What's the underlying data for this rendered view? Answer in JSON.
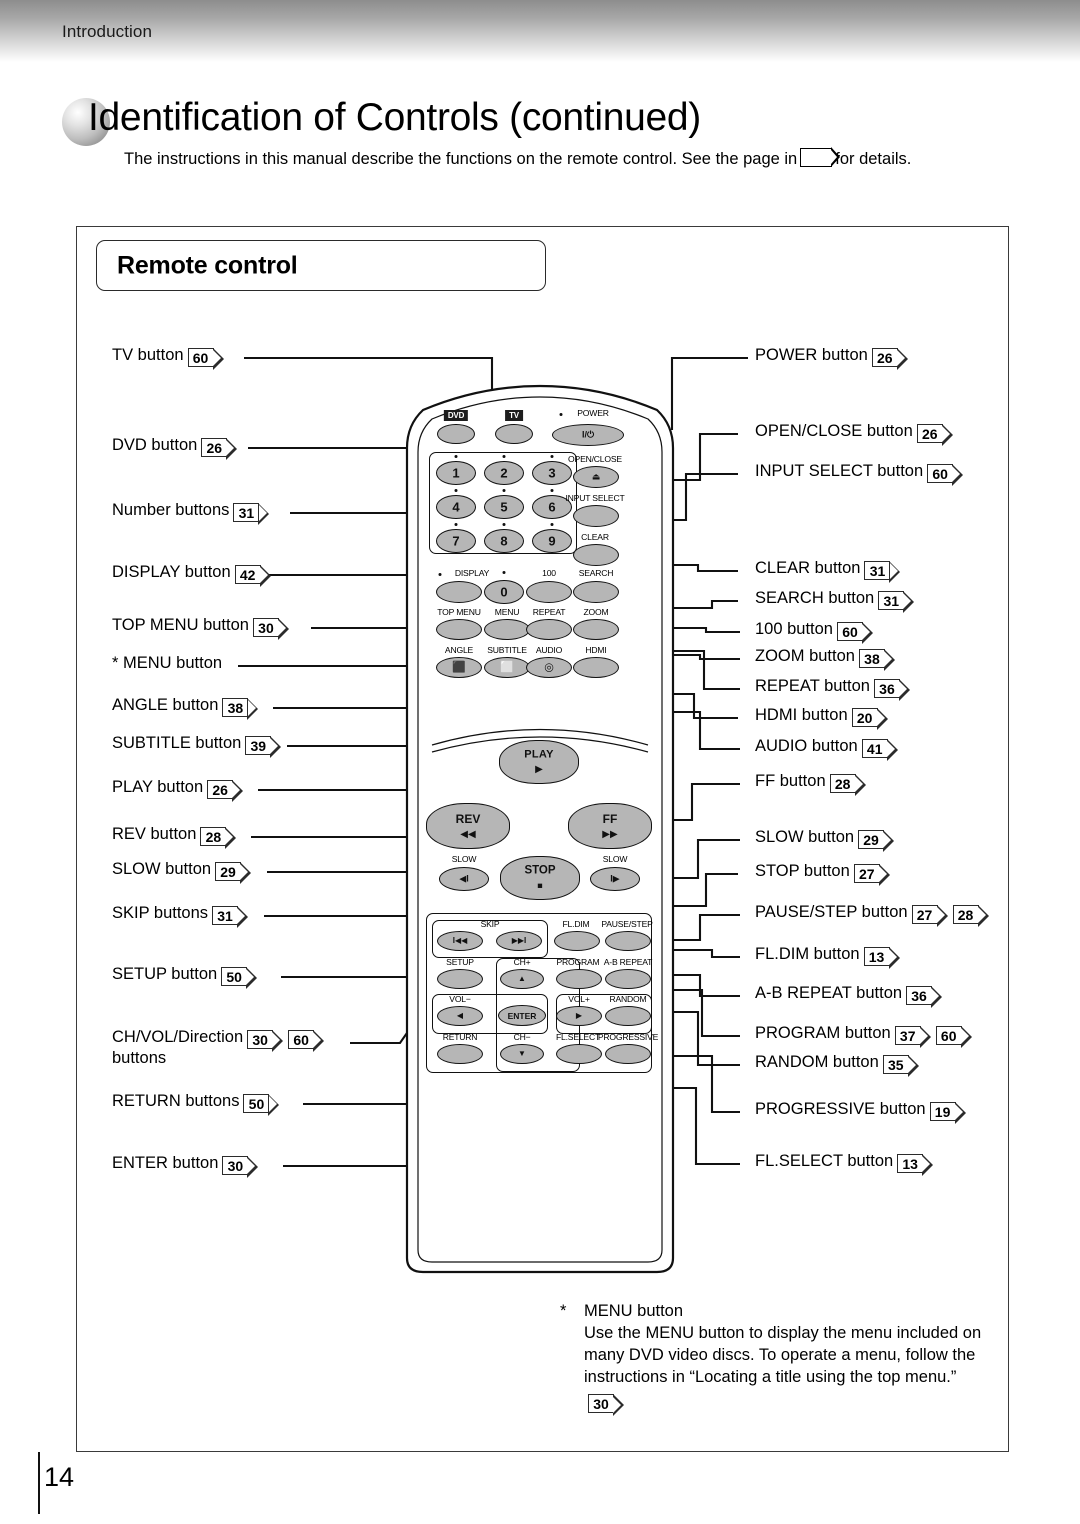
{
  "header": {
    "breadcrumb": "Introduction",
    "title": "Identification of Controls (continued)",
    "subtitle_before": "The instructions in this manual describe the functions on the remote control. See the page in",
    "subtitle_after": "for details."
  },
  "section": {
    "title": "Remote control"
  },
  "left_labels": [
    {
      "name": "tv",
      "text": "TV button",
      "tags": [
        "60"
      ]
    },
    {
      "name": "dvd",
      "text": "DVD button",
      "tags": [
        "26"
      ]
    },
    {
      "name": "number",
      "text": "Number buttons",
      "tags": [
        "31"
      ]
    },
    {
      "name": "display",
      "text": "DISPLAY button",
      "tags": [
        "42"
      ]
    },
    {
      "name": "top-menu",
      "text": "TOP MENU button",
      "tags": [
        "30"
      ]
    },
    {
      "name": "menu",
      "text": "* MENU button",
      "tags": []
    },
    {
      "name": "angle",
      "text": "ANGLE button",
      "tags": [
        "38"
      ]
    },
    {
      "name": "subtitle",
      "text": "SUBTITLE button",
      "tags": [
        "39"
      ]
    },
    {
      "name": "play",
      "text": "PLAY button",
      "tags": [
        "26"
      ]
    },
    {
      "name": "rev",
      "text": "REV button",
      "tags": [
        "28"
      ]
    },
    {
      "name": "slow",
      "text": "SLOW button",
      "tags": [
        "29"
      ]
    },
    {
      "name": "skip",
      "text": "SKIP buttons",
      "tags": [
        "31"
      ]
    },
    {
      "name": "setup",
      "text": "SETUP button",
      "tags": [
        "50"
      ]
    },
    {
      "name": "chvol",
      "text": "CH/VOL/Direction",
      "tags": [
        "30",
        "60"
      ],
      "second_line": "buttons"
    },
    {
      "name": "return",
      "text": "RETURN buttons",
      "tags": [
        "50"
      ]
    },
    {
      "name": "enter",
      "text": "ENTER button",
      "tags": [
        "30"
      ]
    }
  ],
  "right_labels": [
    {
      "name": "power",
      "text": "POWER button",
      "tags": [
        "26"
      ]
    },
    {
      "name": "open-close",
      "text": "OPEN/CLOSE button",
      "tags": [
        "26"
      ]
    },
    {
      "name": "input-select",
      "text": "INPUT SELECT button",
      "tags": [
        "60"
      ]
    },
    {
      "name": "clear",
      "text": "CLEAR button",
      "tags": [
        "31"
      ]
    },
    {
      "name": "search",
      "text": "SEARCH button",
      "tags": [
        "31"
      ]
    },
    {
      "name": "hundred",
      "text": "100 button",
      "tags": [
        "60"
      ]
    },
    {
      "name": "zoom",
      "text": "ZOOM button",
      "tags": [
        "38"
      ]
    },
    {
      "name": "repeat",
      "text": "REPEAT button",
      "tags": [
        "36"
      ]
    },
    {
      "name": "hdmi",
      "text": "HDMI button",
      "tags": [
        "20"
      ]
    },
    {
      "name": "audio",
      "text": "AUDIO button",
      "tags": [
        "41"
      ]
    },
    {
      "name": "ff",
      "text": "FF button",
      "tags": [
        "28"
      ]
    },
    {
      "name": "slow",
      "text": "SLOW button",
      "tags": [
        "29"
      ]
    },
    {
      "name": "stop",
      "text": "STOP button",
      "tags": [
        "27"
      ]
    },
    {
      "name": "pause-step",
      "text": "PAUSE/STEP button",
      "tags": [
        "27",
        "28"
      ]
    },
    {
      "name": "fl-dim",
      "text": "FL.DIM button",
      "tags": [
        "13"
      ]
    },
    {
      "name": "ab-repeat",
      "text": "A-B REPEAT button",
      "tags": [
        "36"
      ]
    },
    {
      "name": "program",
      "text": "PROGRAM button",
      "tags": [
        "37",
        "60"
      ]
    },
    {
      "name": "random",
      "text": "RANDOM button",
      "tags": [
        "35"
      ]
    },
    {
      "name": "progressive",
      "text": "PROGRESSIVE button",
      "tags": [
        "19"
      ]
    },
    {
      "name": "fl-select",
      "text": "FL.SELECT button",
      "tags": [
        "13"
      ]
    }
  ],
  "remote": {
    "captions": {
      "dvd": "DVD",
      "tv": "TV",
      "power": "POWER",
      "open_close": "OPEN/CLOSE",
      "input_select": "INPUT SELECT",
      "clear": "CLEAR",
      "display": "DISPLAY",
      "hundred": "100",
      "search": "SEARCH",
      "top_menu": "TOP MENU",
      "menu": "MENU",
      "repeat": "REPEAT",
      "zoom": "ZOOM",
      "angle": "ANGLE",
      "subtitle": "SUBTITLE",
      "audio": "AUDIO",
      "hdmi": "HDMI",
      "play": "PLAY",
      "rev": "REV",
      "ff": "FF",
      "slow_left": "SLOW",
      "slow_right": "SLOW",
      "stop": "STOP",
      "skip": "SKIP",
      "fl_dim": "FL.DIM",
      "pause_step": "PAUSE/STEP",
      "setup": "SETUP",
      "ch_plus": "CH+",
      "program": "PROGRAM",
      "ab_repeat": "A-B REPEAT",
      "vol_minus": "VOL−",
      "enter": "ENTER",
      "vol_plus": "VOL+",
      "random": "RANDOM",
      "return": "RETURN",
      "ch_minus": "CH−",
      "fl_select": "FL.SELECT",
      "progressive": "PROGRESSIVE"
    },
    "numbers": [
      "1",
      "2",
      "3",
      "4",
      "5",
      "6",
      "7",
      "8",
      "9",
      "0"
    ],
    "glyphs": {
      "power": "I/⏻",
      "eject": "⏏",
      "play": "▶",
      "rev": "◀◀",
      "ff": "▶▶",
      "stop": "■",
      "slow_left": "◀I",
      "slow_right": "I▶",
      "skip_prev": "I◀◀",
      "skip_next": "▶▶I",
      "up": "▲",
      "down": "▼",
      "left": "◀",
      "right": "▶",
      "angle": "⬛",
      "subtitle": "⬜",
      "audio": "◎"
    }
  },
  "footnote": {
    "star": "*",
    "heading": "MENU button",
    "line1": "Use the MENU button to display the menu included on",
    "line2": "many DVD video discs. To operate a menu, follow the",
    "line3": "instructions in “Locating a title using the top menu.”",
    "tag": "30"
  },
  "footer": {
    "page_number": "14"
  }
}
